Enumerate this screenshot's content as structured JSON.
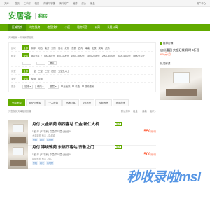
{
  "topbar": {
    "left": "天津 ▾",
    "links": [
      "首页",
      "二手房",
      "租房",
      "商铺写字楼",
      "海外地产",
      "装修",
      "房价",
      "新盘",
      "用户中心"
    ]
  },
  "header": {
    "logo": "安居客",
    "section": "租房"
  },
  "nav": {
    "items": [
      "区域找房",
      "地铁找房",
      "地图找房",
      "小区",
      "租房问答",
      "公寓",
      "长租公寓"
    ]
  },
  "breadcrumb": "天津租房 > 天津房屋租赁",
  "filter": {
    "rows": [
      {
        "label": "区域",
        "options": [
          "全部",
          "和平",
          "河西",
          "南开",
          "河东",
          "河北",
          "红桥",
          "东丽",
          "西青",
          "津南",
          "北辰",
          "滨海",
          "武清"
        ]
      },
      {
        "label": "租金",
        "options": [
          "全部",
          "500元以下",
          "500-800元",
          "800-1000元",
          "1000-1500元",
          "1500-2000元",
          "2000-3000元",
          "3000-4500元",
          "4500元以上"
        ]
      },
      {
        "label": "房型",
        "options": [
          "全部",
          "一室",
          "二室",
          "三室",
          "四室",
          "五室及以上"
        ]
      },
      {
        "label": "类型",
        "options": [
          "全部",
          "整租",
          "合租"
        ]
      }
    ],
    "rent_button": "确定",
    "more_label": "更多",
    "more_selects": [
      "装修",
      "朝向",
      "楼层"
    ],
    "checks": [
      "近地铁",
      "精选",
      "视频看房"
    ]
  },
  "tabs": [
    "全部房源",
    "经纪人房源",
    "个人房源",
    "品牌公寓",
    "VR看房",
    "视频看房",
    "地图找房"
  ],
  "sortbar": {
    "count": "为您找到天津租房房源",
    "options": [
      "默认排序",
      "租金 ↑",
      "最新",
      "面积 ↑"
    ]
  },
  "listings": [
    {
      "title": "月付 大金新苑 临西客站 汇金 新仁大桥",
      "badge": "安选",
      "meta": "1室1厅 | 33平米 | 高层(共32层) | 经纪人",
      "address": "大金新苑 西青 - 中北镇",
      "tags": [
        "整租",
        "朝南",
        "有电梯"
      ],
      "price": "550",
      "unit": "元/月"
    },
    {
      "title": "月付 锦绣雅苑 东临西客站 齐鲁之门",
      "badge": "安选",
      "meta": "1室1厅 | 33平米 | 中层(共18层) | 经纪人",
      "address": "锦绣雅苑 西青 - 辛口",
      "tags": [
        "整租",
        "朝北",
        "有电梯"
      ],
      "price": "500",
      "unit": "元/月"
    }
  ],
  "sidebar": {
    "heading": "推荐房源",
    "text": "启航嘉园 大金汇城 翔时 5折租",
    "price": "600元/月",
    "heading2": "热门房源"
  },
  "watermark": "秒收录啦msl"
}
